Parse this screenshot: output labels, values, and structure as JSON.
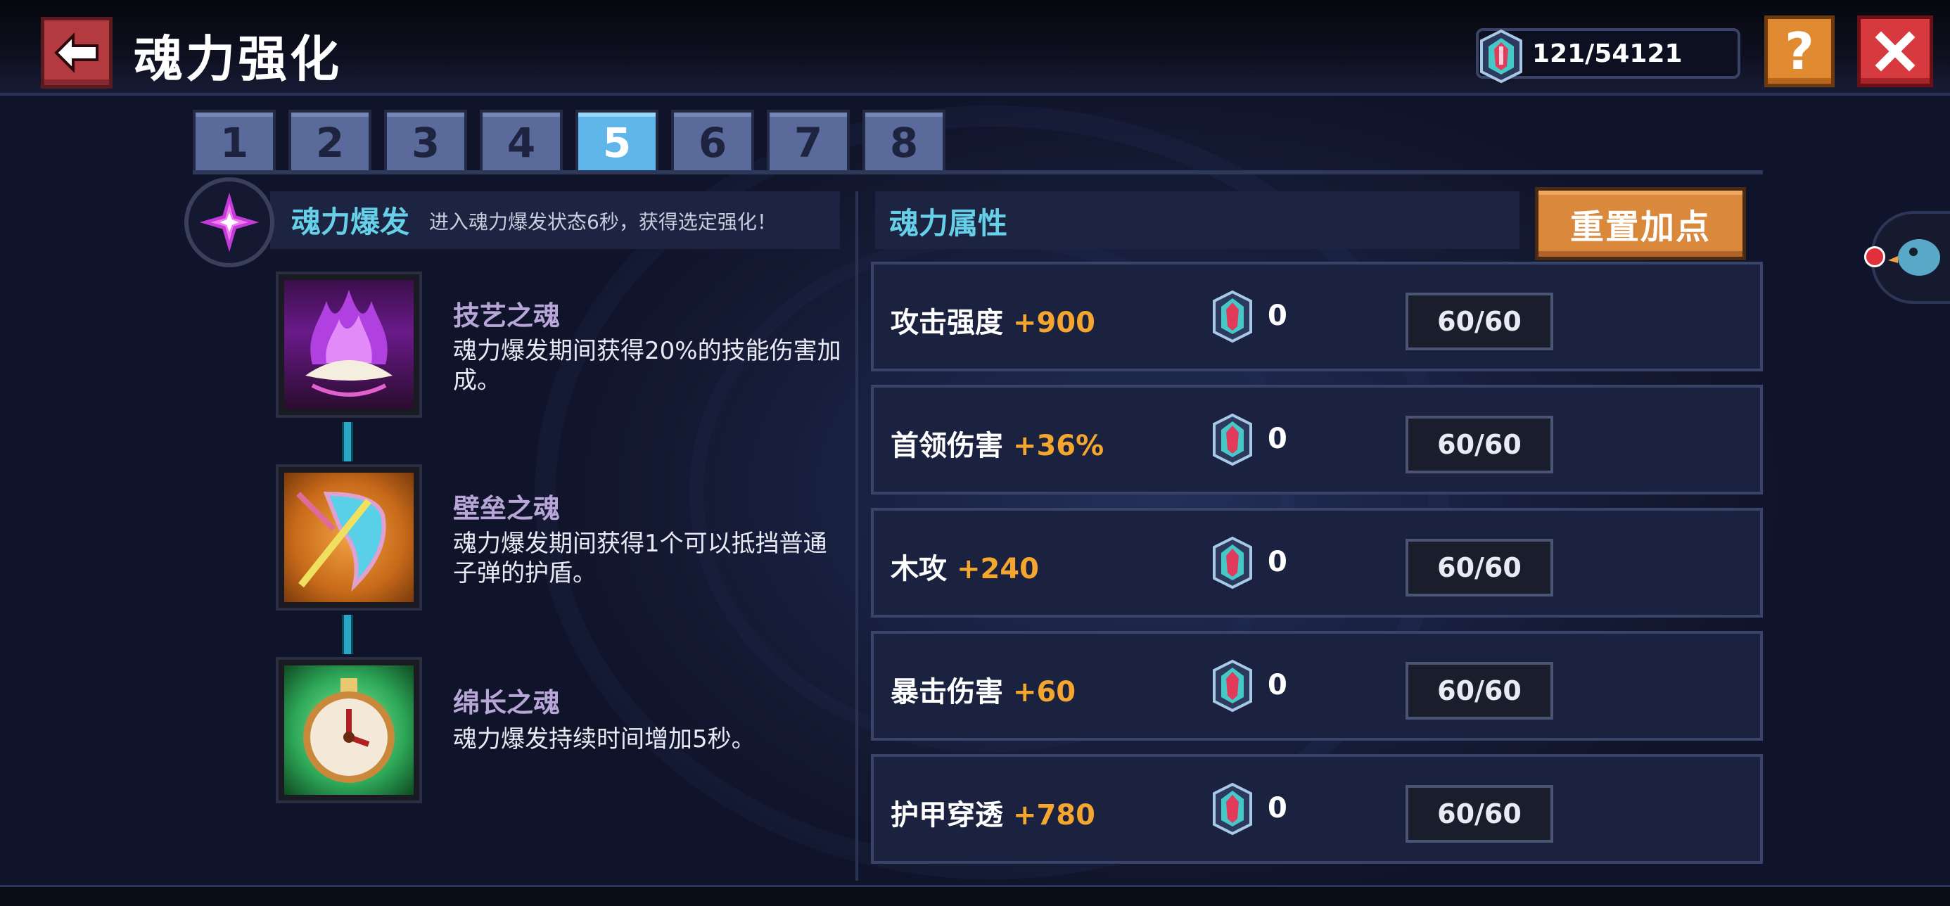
{
  "header": {
    "title": "魂力强化",
    "currency": "121/54121"
  },
  "tabs": [
    "1",
    "2",
    "3",
    "4",
    "5",
    "6",
    "7",
    "8"
  ],
  "active_tab": "5",
  "burst": {
    "name": "魂力爆发",
    "desc": "进入魂力爆发状态6秒，获得选定强化！"
  },
  "skills": [
    {
      "name": "技艺之魂",
      "desc": "魂力爆发期间获得20%的技能伤害加成。",
      "icon": "purple-flame-icon"
    },
    {
      "name": "壁垒之魂",
      "desc": "魂力爆发期间获得1个可以抵挡普通子弹的护盾。",
      "icon": "shield-icon"
    },
    {
      "name": "绵长之魂",
      "desc": "魂力爆发持续时间增加5秒。",
      "icon": "stopwatch-icon"
    }
  ],
  "attributes": {
    "title": "魂力属性",
    "reset_label": "重置加点",
    "rows": [
      {
        "label": "攻击强度",
        "bonus": "+900",
        "count": "0",
        "level": "60/60"
      },
      {
        "label": "首领伤害",
        "bonus": "+36%",
        "count": "0",
        "level": "60/60"
      },
      {
        "label": "木攻",
        "bonus": "+240",
        "count": "0",
        "level": "60/60"
      },
      {
        "label": "暴击伤害",
        "bonus": "+60",
        "count": "0",
        "level": "60/60"
      },
      {
        "label": "护甲穿透",
        "bonus": "+780",
        "count": "0",
        "level": "60/60"
      }
    ]
  },
  "colors": {
    "accent_cyan": "#66d0e8",
    "bonus_orange": "#f4a62e",
    "active_tab": "#5fb6ea",
    "reset_button": "#d9883c",
    "close_button": "#d63a3f",
    "help_button": "#e08a32"
  }
}
